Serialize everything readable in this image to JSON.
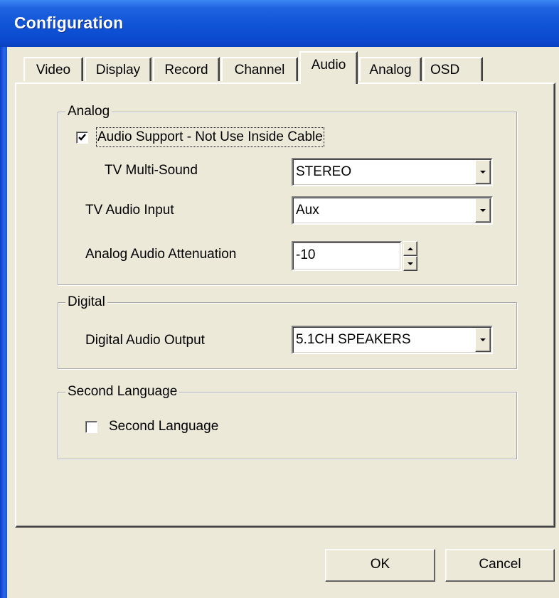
{
  "window": {
    "title": "Configuration"
  },
  "tabs": [
    {
      "label": "Video"
    },
    {
      "label": "Display"
    },
    {
      "label": "Record"
    },
    {
      "label": "Channel"
    },
    {
      "label": "Audio",
      "selected": true
    },
    {
      "label": "Analog"
    },
    {
      "label": "OSD"
    }
  ],
  "analog": {
    "group_title": "Analog",
    "audio_support": {
      "label": "Audio Support - Not Use Inside Cable",
      "checked": true
    },
    "tv_multi_sound": {
      "label": "TV Multi-Sound",
      "value": "STEREO"
    },
    "tv_audio_input": {
      "label": "TV Audio Input",
      "value": "Aux"
    },
    "attenuation": {
      "label": "Analog Audio Attenuation",
      "value": "-10"
    }
  },
  "digital": {
    "group_title": "Digital",
    "output": {
      "label": "Digital Audio Output",
      "value": "5.1CH SPEAKERS"
    }
  },
  "second_language": {
    "group_title": "Second Language",
    "checkbox": {
      "label": "Second Language",
      "checked": false
    }
  },
  "buttons": {
    "ok": "OK",
    "cancel": "Cancel"
  },
  "colors": {
    "titlebar": "#0b4ad0",
    "face": "#ece9d8"
  }
}
